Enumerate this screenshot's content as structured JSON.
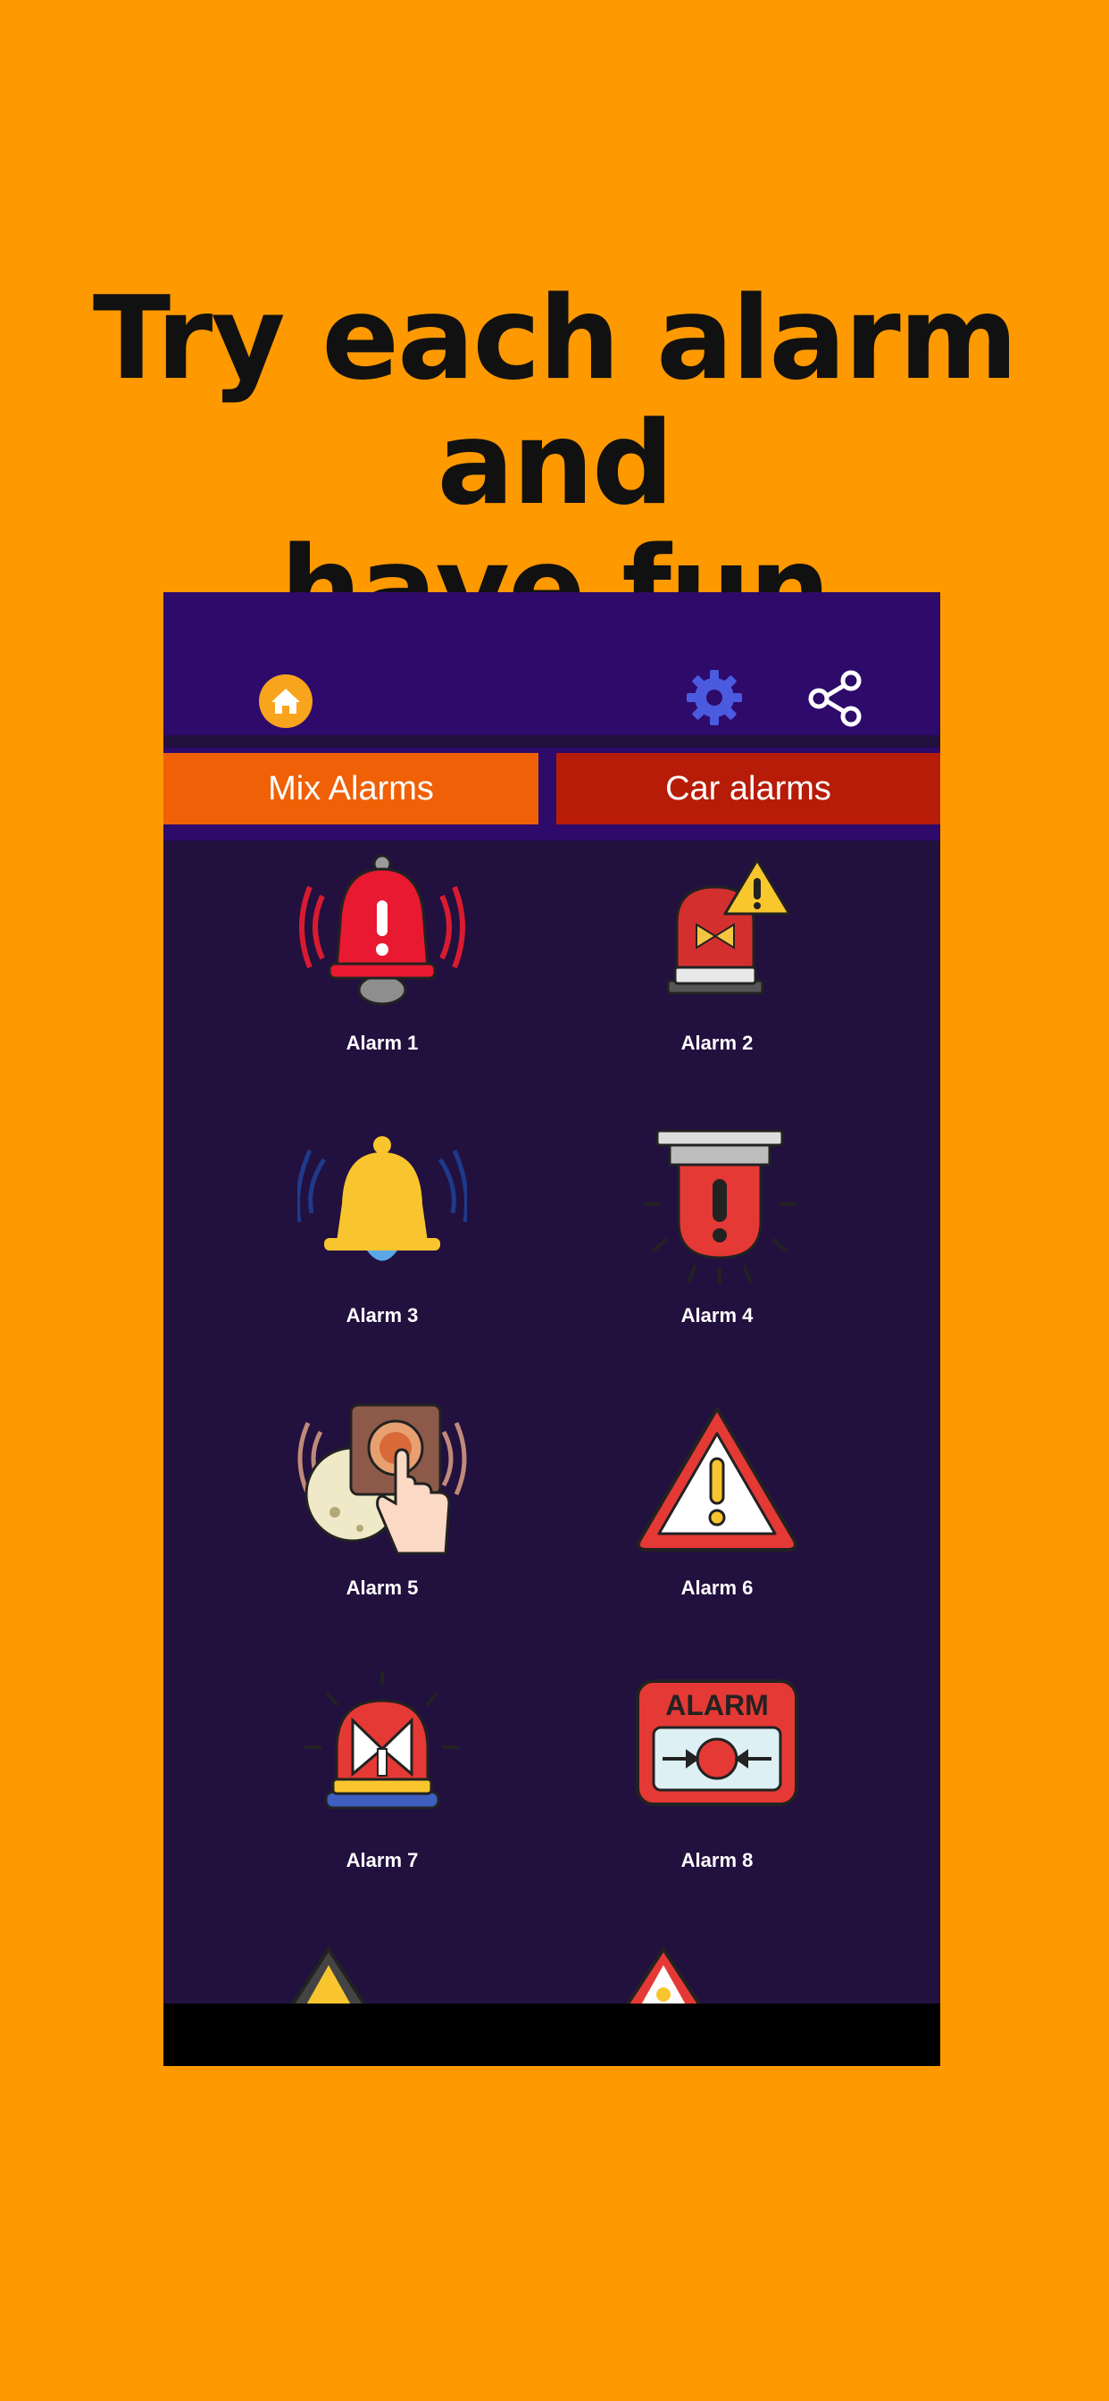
{
  "headline": {
    "line1": "Try each alarm and",
    "line2": "have fun"
  },
  "app": {
    "icons": [
      "home-icon",
      "gear-icon",
      "share-icon"
    ],
    "tabs": {
      "mix": "Mix Alarms",
      "car": "Car alarms"
    },
    "alarms": [
      {
        "label": "Alarm 1"
      },
      {
        "label": "Alarm 2"
      },
      {
        "label": "Alarm 3"
      },
      {
        "label": "Alarm 4"
      },
      {
        "label": "Alarm 5"
      },
      {
        "label": "Alarm 6"
      },
      {
        "label": "Alarm 7"
      },
      {
        "label": "Alarm 8"
      }
    ]
  },
  "colors": {
    "background": "#FF9900",
    "app_bg": "#22103F",
    "topbar": "#2E0A6B",
    "tab_mix": "#F06007",
    "tab_car": "#B71C08"
  }
}
